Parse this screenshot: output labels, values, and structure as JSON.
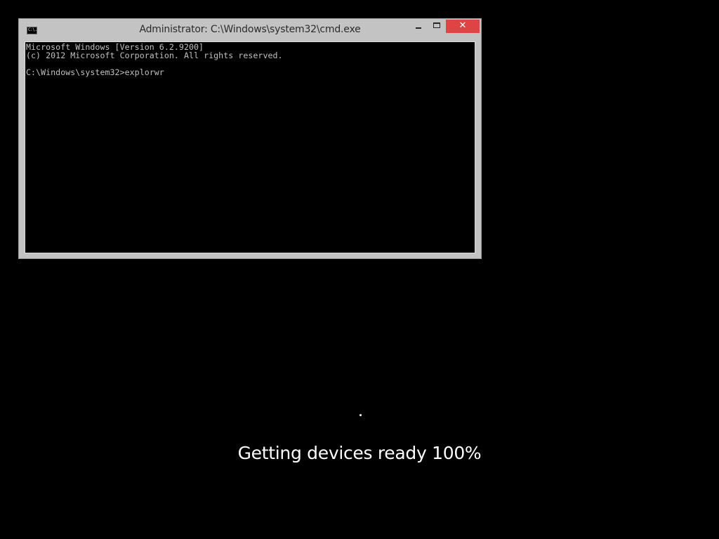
{
  "window": {
    "title": "Administrator: C:\\Windows\\system32\\cmd.exe",
    "icon": "cmd-icon",
    "icon_glyph": "C:\\.",
    "close_glyph": "✕",
    "accent_close_color": "#e04343"
  },
  "console": {
    "lines": [
      "Microsoft Windows [Version 6.2.9200]",
      "(c) 2012 Microsoft Corporation. All rights reserved.",
      "",
      "C:\\Windows\\system32>explorwr"
    ]
  },
  "status": {
    "message": "Getting devices ready 100%",
    "progress_percent": 100
  }
}
